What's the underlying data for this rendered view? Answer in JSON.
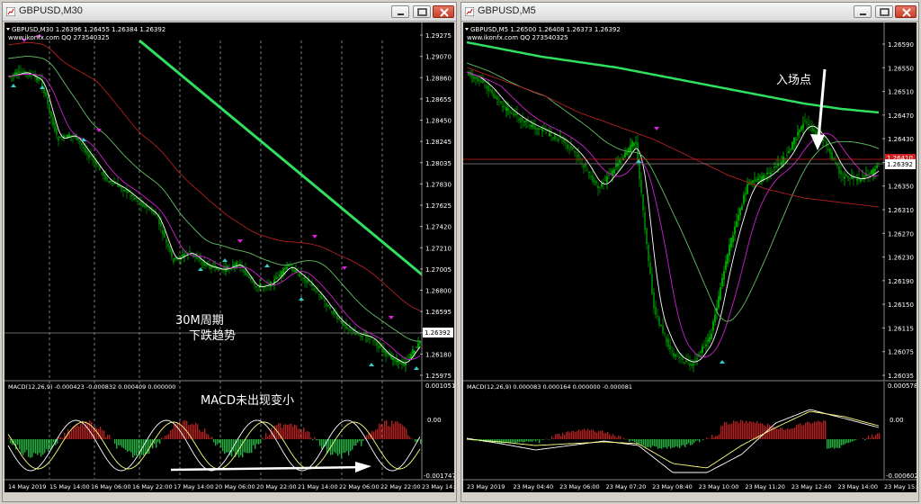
{
  "windows": [
    {
      "title": "GBPUSD,M30",
      "header_line1": "GBPUSD,M30  1.26396 1.26455 1.26384 1.26392",
      "header_line2": "www.ikonfx.com   QQ 273540325",
      "price_labels": [
        "1.29275",
        "1.29070",
        "1.28860",
        "1.28655",
        "1.28450",
        "1.28245",
        "1.28035",
        "1.27830",
        "1.27625",
        "1.27420",
        "1.27210",
        "1.27005",
        "1.26800",
        "1.26595",
        "1.26390",
        "1.26180",
        "1.25975"
      ],
      "current_price": "1.26392",
      "macd_header": "MACD(12,26,9) -0.000423 -0.000832 0.000409 0.000000",
      "macd_labels": [
        "0.001051",
        "0.00",
        "-0.001747"
      ],
      "time_labels": [
        "14 May 2019",
        "15 May 14:00",
        "16 May 06:00",
        "16 May 22:00",
        "17 May 14:00",
        "20 May 06:00",
        "20 May 22:00",
        "21 May 14:00",
        "22 May 06:00",
        "22 May 22:00",
        "23 May 14:00"
      ],
      "annotation_title": "30M周期",
      "annotation_sub": "下跌趋势",
      "annotation_macd": "MACD未出现变小"
    },
    {
      "title": "GBPUSD,M5",
      "header_line1": "GBPUSD,M5  1.26500 1.26408 1.26373 1.26392",
      "header_line2": "www.ikonfx.com   QQ 273540325",
      "price_labels": [
        "1.26590",
        "1.26550",
        "1.26510",
        "1.26470",
        "1.26430",
        "1.26392",
        "1.26350",
        "1.26310",
        "1.26270",
        "1.26230",
        "1.26190",
        "1.26150",
        "1.26115",
        "1.26075",
        "1.26035"
      ],
      "current_price": "1.26392",
      "red_price": "1.26410",
      "macd_header": "MACD(12,26,9) 0.000083 0.000164 0.000000 -0.000081",
      "macd_labels": [
        "0.000578",
        "0.00",
        "-0.000602"
      ],
      "time_labels": [
        "23 May 2019",
        "23 May 04:40",
        "23 May 06:00",
        "23 May 07:20",
        "23 May 08:40",
        "23 May 10:00",
        "23 May 11:20",
        "23 May 12:40",
        "23 May 14:00",
        "23 May 15:20"
      ],
      "annotation_entry": "入场点"
    }
  ],
  "colors": {
    "bull": "#00e000",
    "bear": "#00a000",
    "ma_fast": "#ffffff",
    "ma_mid": "#d020d0",
    "ma_slow": "#b02020",
    "ma_long": "#30e060",
    "macd_pos": "#b02020",
    "macd_neg": "#20b040",
    "signal": "#ffff80",
    "up_arrow": "#30d0d0",
    "down_arrow": "#e020e0"
  }
}
